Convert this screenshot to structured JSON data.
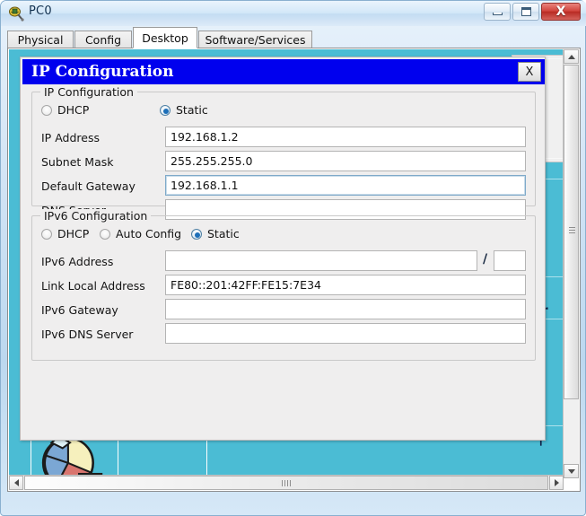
{
  "window": {
    "title": "PC0",
    "icon": "device-icon",
    "buttons": {
      "minimize": "minimize-icon",
      "maximize": "maximize-icon",
      "close": "X"
    }
  },
  "tabs": [
    {
      "label": "Physical",
      "active": false
    },
    {
      "label": "Config",
      "active": false
    },
    {
      "label": "Desktop",
      "active": true
    },
    {
      "label": "Software/Services",
      "active": false
    }
  ],
  "dialog": {
    "title": "IP Configuration",
    "close_label": "X",
    "ipv4": {
      "legend": "IP Configuration",
      "modes": [
        {
          "label": "DHCP",
          "selected": false
        },
        {
          "label": "Static",
          "selected": true
        }
      ],
      "fields": [
        {
          "label": "IP Address",
          "value": "192.168.1.2",
          "focused": false
        },
        {
          "label": "Subnet Mask",
          "value": "255.255.255.0",
          "focused": false
        },
        {
          "label": "Default Gateway",
          "value": "192.168.1.1",
          "focused": true
        },
        {
          "label": "DNS Server",
          "value": "",
          "focused": false
        }
      ]
    },
    "ipv6": {
      "legend": "IPv6 Configuration",
      "modes": [
        {
          "label": "DHCP",
          "selected": false
        },
        {
          "label": "Auto Config",
          "selected": false
        },
        {
          "label": "Static",
          "selected": true
        }
      ],
      "address_label": "IPv6 Address",
      "address_value": "",
      "prefix_separator": "/",
      "prefix_value": "",
      "fields": [
        {
          "label": "Link Local Address",
          "value": "FE80::201:42FF:FE15:7E34"
        },
        {
          "label": "IPv6 Gateway",
          "value": ""
        },
        {
          "label": "IPv6 DNS Server",
          "value": ""
        }
      ]
    }
  },
  "background": {
    "desktop_color": "#4bbcd4",
    "partial_labels": [
      {
        "text": "r"
      },
      {
        "text": "or"
      }
    ],
    "icons": [
      {
        "name": "pie-chart-icon"
      }
    ]
  },
  "scrollbars": {
    "vertical": {
      "up": "scroll-up-icon",
      "down": "scroll-down-icon"
    },
    "horizontal": {
      "left": "scroll-left-icon",
      "right": "scroll-right-icon"
    }
  },
  "colors": {
    "dialog_title_bg": "#0000EE",
    "desktop": "#4BBCD4",
    "radio_selected": "#1D6FB8",
    "close_button": "#B82B24"
  }
}
